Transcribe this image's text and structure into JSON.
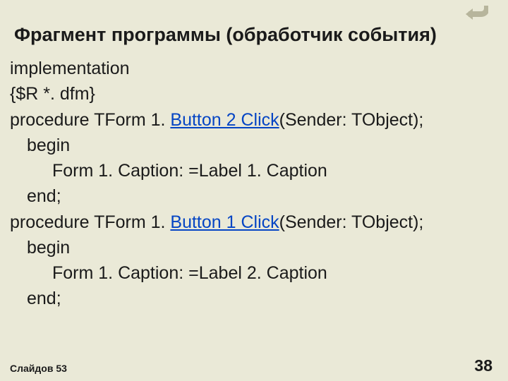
{
  "title": "Фрагмент программы (обработчик события)",
  "icon_name": "return-icon",
  "code": {
    "l1": "implementation",
    "l2": "{$R *. dfm}",
    "l3a": "procedure TForm 1. ",
    "l3link": "Button 2 Click",
    "l3b": "(Sender: TObject);",
    "l4": "begin",
    "l5": "Form 1. Caption: =Label 1. Caption",
    "l6": "end;",
    "l7a": "procedure TForm 1. ",
    "l7link": "Button 1 Click",
    "l7b": "(Sender: TObject);",
    "l8": "begin",
    "l9": "Form 1. Caption: =Label 2. Caption",
    "l10": "end;"
  },
  "footer": {
    "left": "Слайдов 53",
    "right": "38"
  }
}
